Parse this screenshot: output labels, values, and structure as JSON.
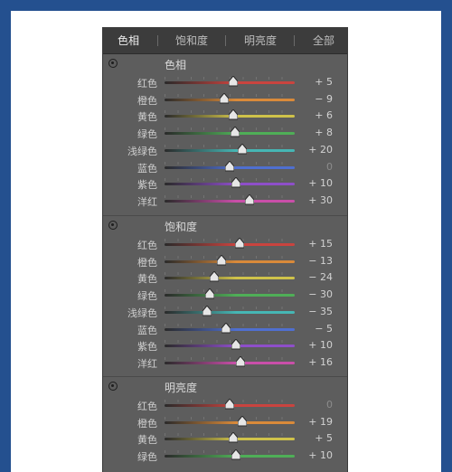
{
  "tabs": [
    {
      "label": "色相",
      "active": true
    },
    {
      "label": "饱和度",
      "active": false
    },
    {
      "label": "明亮度",
      "active": false
    },
    {
      "label": "全部",
      "active": false
    }
  ],
  "icons": {
    "section_toggle": "target-radio-icon",
    "slider_thumb": "slider-thumb-icon"
  },
  "slider_range": [
    -100,
    100
  ],
  "sections": [
    {
      "title": "色相",
      "rows": [
        {
          "label": "红色",
          "value_text": "+ 5",
          "value": 5,
          "track": "#c9443f"
        },
        {
          "label": "橙色",
          "value_text": "− 9",
          "value": -9,
          "track": "#d98a3a"
        },
        {
          "label": "黄色",
          "value_text": "+ 6",
          "value": 6,
          "track": "#cfc24a"
        },
        {
          "label": "绿色",
          "value_text": "+ 8",
          "value": 8,
          "track": "#4fae57"
        },
        {
          "label": "浅绿色",
          "value_text": "+ 20",
          "value": 20,
          "track": "#46b6b4"
        },
        {
          "label": "蓝色",
          "value_text": "0",
          "value": 0,
          "track": "#4f6fd0"
        },
        {
          "label": "紫色",
          "value_text": "+ 10",
          "value": 10,
          "track": "#8e4fc9"
        },
        {
          "label": "洋红",
          "value_text": "+ 30",
          "value": 30,
          "track": "#c94fa9"
        }
      ]
    },
    {
      "title": "饱和度",
      "rows": [
        {
          "label": "红色",
          "value_text": "+ 15",
          "value": 15,
          "track": "#c9443f"
        },
        {
          "label": "橙色",
          "value_text": "− 13",
          "value": -13,
          "track": "#d98a3a"
        },
        {
          "label": "黄色",
          "value_text": "− 24",
          "value": -24,
          "track": "#cfc24a"
        },
        {
          "label": "绿色",
          "value_text": "− 30",
          "value": -30,
          "track": "#4fae57"
        },
        {
          "label": "浅绿色",
          "value_text": "− 35",
          "value": -35,
          "track": "#46b6b4"
        },
        {
          "label": "蓝色",
          "value_text": "− 5",
          "value": -5,
          "track": "#4f6fd0"
        },
        {
          "label": "紫色",
          "value_text": "+ 10",
          "value": 10,
          "track": "#8e4fc9"
        },
        {
          "label": "洋红",
          "value_text": "+ 16",
          "value": 16,
          "track": "#c94fa9"
        }
      ]
    },
    {
      "title": "明亮度",
      "rows": [
        {
          "label": "红色",
          "value_text": "0",
          "value": 0,
          "track": "#c9443f"
        },
        {
          "label": "橙色",
          "value_text": "+ 19",
          "value": 19,
          "track": "#d98a3a"
        },
        {
          "label": "黄色",
          "value_text": "+ 5",
          "value": 5,
          "track": "#cfc24a"
        },
        {
          "label": "绿色",
          "value_text": "+ 10",
          "value": 10,
          "track": "#4fae57"
        }
      ]
    }
  ]
}
